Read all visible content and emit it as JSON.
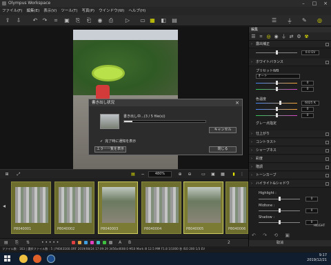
{
  "window": {
    "title": "Olympus Workspace"
  },
  "menu": [
    "ファイル(F)",
    "編集(E)",
    "表示(V)",
    "ツール(T)",
    "写真(P)",
    "ウインドウ(W)",
    "ヘルプ(H)"
  ],
  "right_panel": {
    "title": "編集",
    "rows": {
      "exposure": "露出補正",
      "white_balance": "ホワイトバランス",
      "finish": "仕上がり",
      "contrast": "コントラスト",
      "sharpness": "シャープネス",
      "saturation": "彩度",
      "gradation": "階調",
      "tone_curve": "トーンカーブ",
      "highlight_shadow": "ハイライト&シャドウ"
    },
    "exposure_value": "0.0 EV",
    "wb_preset_label": "プリセットWB",
    "wb_mode": "オート",
    "wb_val1": "0",
    "wb_val2": "0",
    "color_temp_label": "色温度",
    "color_temp_value": "6025 K",
    "ct_val1": "0",
    "ct_val2": "0",
    "gray_point_label": "グレー点指定",
    "highlight_label": "Highlight :",
    "highlight_value": "0",
    "midtone_label": "Midtone :",
    "midtone_value": "0",
    "shadow_label": "Shadow :",
    "shadow_value": "0",
    "hilight_tag": "HILIGHT",
    "footer_label": "取消"
  },
  "viewer": {
    "zoom": "480%",
    "filmstrip_counter": "2"
  },
  "dialog": {
    "title": "書き出し状況",
    "message": "書き出し中...(3 / 5 file(s))",
    "progress": 0.1,
    "cancel_label": "キャンセル",
    "checkbox_label": "完了時に通知を表示",
    "error_list_label": "エラー一覧を表示",
    "close_label": "閉じる"
  },
  "thumbs": [
    {
      "cap": "P8040001"
    },
    {
      "cap": "P8040002"
    },
    {
      "cap": "P8040003"
    },
    {
      "cap": "P8040004"
    },
    {
      "cap": "P8040005"
    },
    {
      "cap": "P8040006"
    }
  ],
  "status_text": "ファイル数 : 163 | 選択ファイル数 : 5 | P4043160.ORF 2019/08/24 17:09:29 3456x4608 E-M10 Mark III 12.5 MM F1.8 1/1000 秒 ISO 200 1/3 EV",
  "taskbar": {
    "time": "9:17",
    "date": "2019/12/21"
  },
  "colors": {
    "accent_green": "#b9e14a",
    "thumb_border": "#8a8a3c"
  }
}
